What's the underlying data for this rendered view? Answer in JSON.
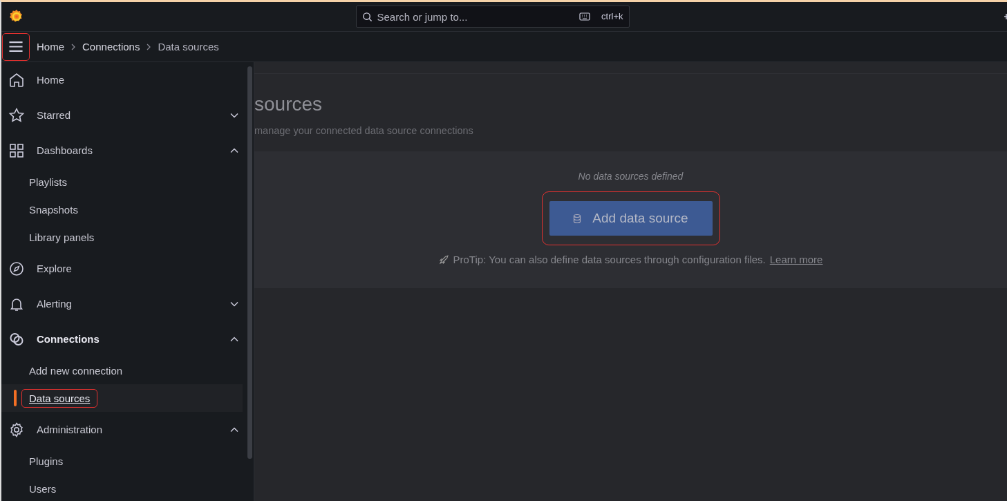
{
  "topbar": {
    "search": {
      "placeholder": "Search or jump to...",
      "shortcut": "ctrl+k"
    }
  },
  "breadcrumb": {
    "menu_highlighted": true,
    "items": [
      {
        "label": "Home",
        "current": false
      },
      {
        "label": "Connections",
        "current": false
      },
      {
        "label": "Data sources",
        "current": true
      }
    ]
  },
  "sidebar": {
    "items": [
      {
        "label": "Home",
        "selected": false
      },
      {
        "label": "Starred",
        "expanded": false,
        "selected": false
      },
      {
        "label": "Dashboards",
        "expanded": true,
        "selected": false,
        "children": [
          {
            "label": "Playlists",
            "selected": false,
            "highlighted": false
          },
          {
            "label": "Snapshots",
            "selected": false,
            "highlighted": false
          },
          {
            "label": "Library panels",
            "selected": false,
            "highlighted": false
          }
        ]
      },
      {
        "label": "Explore",
        "selected": false
      },
      {
        "label": "Alerting",
        "expanded": false,
        "selected": false
      },
      {
        "label": "Connections",
        "expanded": true,
        "selected": true,
        "children": [
          {
            "label": "Add new connection",
            "selected": false,
            "highlighted": false
          },
          {
            "label": "Data sources",
            "selected": true,
            "highlighted": true
          }
        ]
      },
      {
        "label": "Administration",
        "expanded": true,
        "selected": false,
        "children": [
          {
            "label": "Plugins",
            "selected": false,
            "highlighted": false
          },
          {
            "label": "Users",
            "selected": false,
            "highlighted": false
          }
        ]
      }
    ]
  },
  "page": {
    "title": "sources",
    "subtitle": "manage your connected data source connections",
    "empty_state": {
      "message": "No data sources defined",
      "button": {
        "label": "Add data source",
        "highlighted": true
      },
      "tip": "ProTip: You can also define data sources through configuration files.",
      "link": "Learn more"
    }
  }
}
